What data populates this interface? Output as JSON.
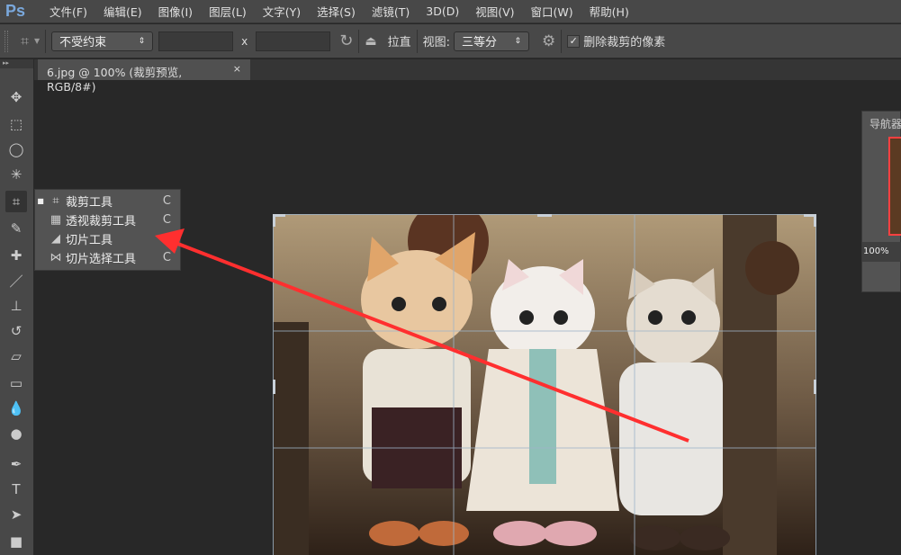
{
  "app": {
    "logo": "Ps"
  },
  "menu": [
    "文件(F)",
    "编辑(E)",
    "图像(I)",
    "图层(L)",
    "文字(Y)",
    "选择(S)",
    "滤镜(T)",
    "3D(D)",
    "视图(V)",
    "窗口(W)",
    "帮助(H)"
  ],
  "options": {
    "ratio_select": "不受约束",
    "width_value": "",
    "x_label": "x",
    "height_value": "",
    "straighten_label": "拉直",
    "view_label": "视图:",
    "view_select": "三等分",
    "delete_pixels_label": "删除裁剪的像素",
    "delete_pixels_checked": true
  },
  "document_tab": {
    "title": "6.jpg @ 100% (裁剪预览, RGB/8#)",
    "close": "×"
  },
  "flyout": [
    {
      "label": "裁剪工具",
      "key": "C",
      "active": true
    },
    {
      "label": "透视裁剪工具",
      "key": "C"
    },
    {
      "label": "切片工具",
      "key": "C"
    },
    {
      "label": "切片选择工具",
      "key": "C"
    }
  ],
  "navigator": {
    "title": "导航器",
    "zoom": "100%"
  },
  "colors": {
    "accent": "#ff3b3b",
    "bg": "#282828",
    "panel": "#484848"
  }
}
